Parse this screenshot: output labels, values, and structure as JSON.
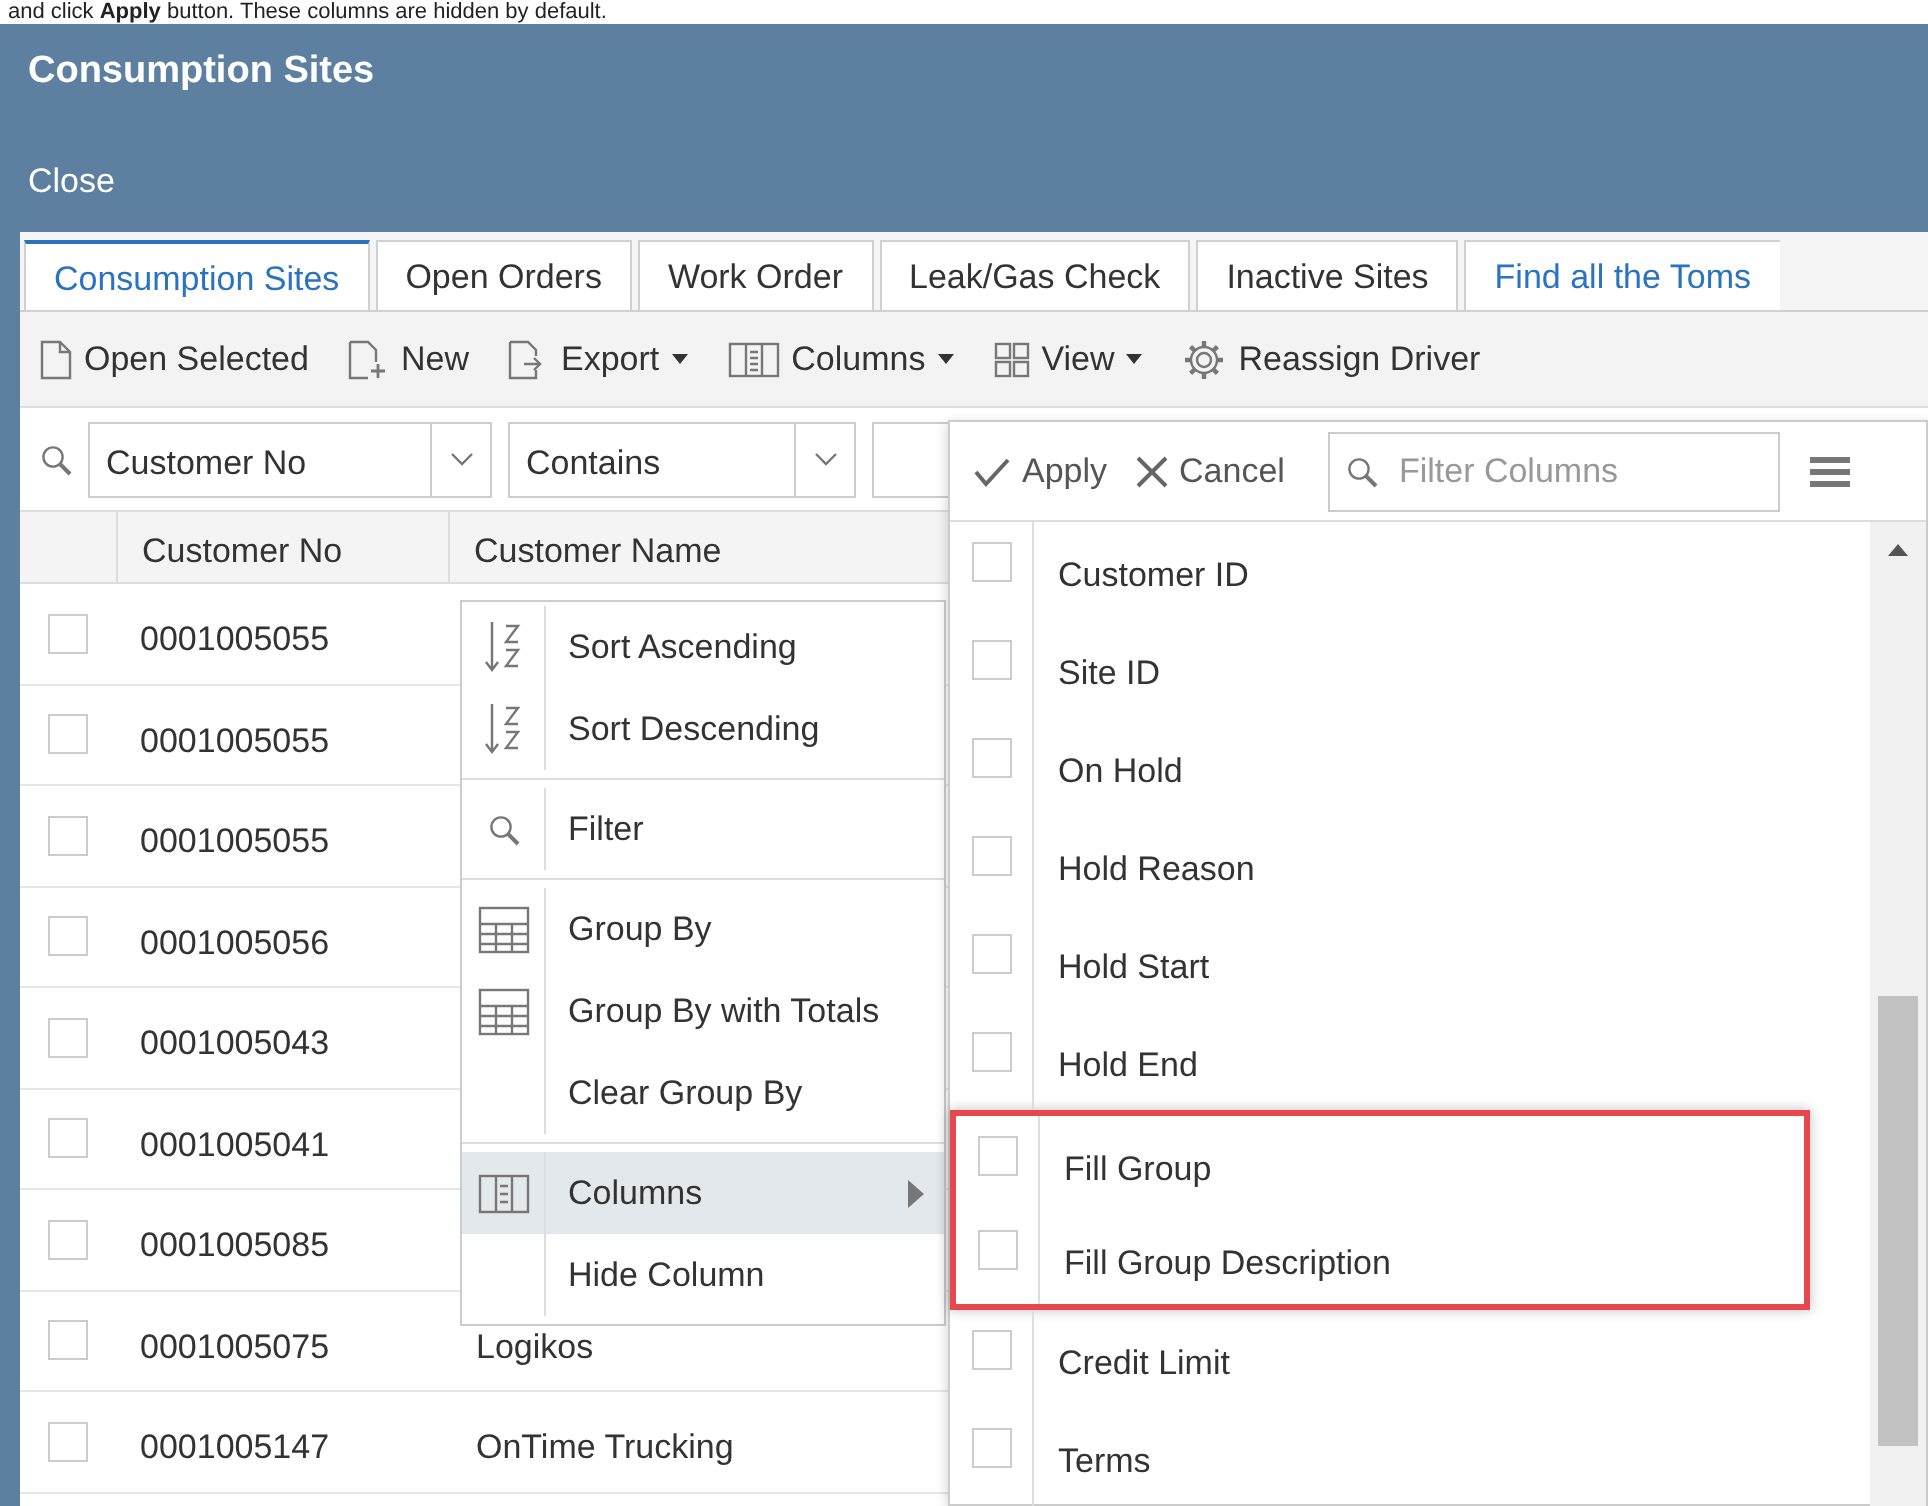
{
  "caption": "and click **Apply** button. These columns are hidden by default.",
  "window": {
    "title": "Consumption Sites"
  },
  "menu": [
    "Close"
  ],
  "tabs": [
    {
      "label": "Consumption Sites",
      "selected": true
    },
    {
      "label": "Open Orders",
      "selected": false
    },
    {
      "label": "Work Order",
      "selected": false
    },
    {
      "label": "Leak/Gas Check",
      "selected": false
    },
    {
      "label": "Inactive Sites",
      "selected": false
    },
    {
      "label": "Find all the Toms",
      "selected": false
    }
  ],
  "toolbar": [
    {
      "label": "Open Selected",
      "dropdown": false
    },
    {
      "label": "New",
      "dropdown": false
    },
    {
      "label": "Export",
      "dropdown": true
    },
    {
      "label": "Columns",
      "dropdown": true
    },
    {
      "label": "View",
      "dropdown": true
    },
    {
      "label": "Reassign Driver",
      "dropdown": false
    }
  ],
  "filter": {
    "field": "Customer No",
    "operator": "Contains"
  },
  "grid": {
    "columns": [
      "Customer No",
      "Customer Name"
    ],
    "rows": [
      {
        "checked": false,
        "customer_no": "0001005055"
      },
      {
        "checked": false,
        "customer_no": "0001005055"
      },
      {
        "checked": false,
        "customer_no": "0001005055"
      },
      {
        "checked": false,
        "customer_no": "0001005056"
      },
      {
        "checked": false,
        "customer_no": "0001005043"
      },
      {
        "checked": false,
        "customer_no": "0001005041"
      },
      {
        "checked": false,
        "customer_no": "0001005085"
      },
      {
        "checked": false,
        "customer_no": "0001005075",
        "customer_name": "Logikos"
      },
      {
        "checked": false,
        "customer_no": "0001005147",
        "customer_name": "OnTime Trucking"
      }
    ]
  },
  "context_menu": {
    "groups": [
      [
        {
          "label": "Sort Ascending",
          "kind": "sort-asc",
          "highlighted": false,
          "submenu": false
        },
        {
          "label": "Sort Descending",
          "kind": "sort-desc",
          "highlighted": false,
          "submenu": false
        }
      ],
      [
        {
          "label": "Filter",
          "kind": "search",
          "highlighted": false,
          "submenu": false
        }
      ],
      [
        {
          "label": "Group By",
          "kind": "grid",
          "highlighted": false,
          "submenu": false
        },
        {
          "label": "Group By with Totals",
          "kind": "grid",
          "highlighted": false,
          "submenu": false
        },
        {
          "label": "Clear Group By",
          "kind": "none",
          "highlighted": false,
          "submenu": false
        }
      ],
      [
        {
          "label": "Columns",
          "kind": "columns",
          "highlighted": true,
          "submenu": true
        },
        {
          "label": "Hide Column",
          "kind": "none",
          "highlighted": false,
          "submenu": false
        }
      ]
    ]
  },
  "column_chooser": {
    "apply": "Apply",
    "cancel": "Cancel",
    "search_placeholder": "Filter Columns",
    "items": [
      {
        "label": "Customer ID",
        "checked": false,
        "annotated": false
      },
      {
        "label": "Site ID",
        "checked": false,
        "annotated": false
      },
      {
        "label": "On Hold",
        "checked": false,
        "annotated": false
      },
      {
        "label": "Hold Reason",
        "checked": false,
        "annotated": false
      },
      {
        "label": "Hold Start",
        "checked": false,
        "annotated": false
      },
      {
        "label": "Hold End",
        "checked": false,
        "annotated": false
      },
      {
        "label": "Fill Group",
        "checked": false,
        "annotated": true
      },
      {
        "label": "Fill Group Description",
        "checked": false,
        "annotated": true
      },
      {
        "label": "Credit Limit",
        "checked": false,
        "annotated": false
      },
      {
        "label": "Terms",
        "checked": false,
        "annotated": false
      }
    ]
  }
}
